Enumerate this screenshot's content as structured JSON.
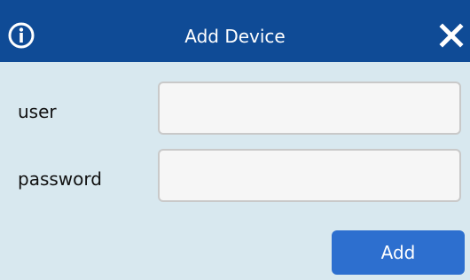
{
  "dialog": {
    "title": "Add Device",
    "icons": {
      "info": "info-icon",
      "close": "close-icon"
    }
  },
  "form": {
    "user": {
      "label": "user",
      "value": ""
    },
    "password": {
      "label": "password",
      "value": ""
    },
    "add_label": "Add"
  },
  "colors": {
    "title_bar": "#0f4b96",
    "dialog_background": "#d8e8ef",
    "button": "#2d6fcf",
    "input_background": "#f6f6f6",
    "input_border": "#c9c9c9",
    "text": "#111111"
  }
}
